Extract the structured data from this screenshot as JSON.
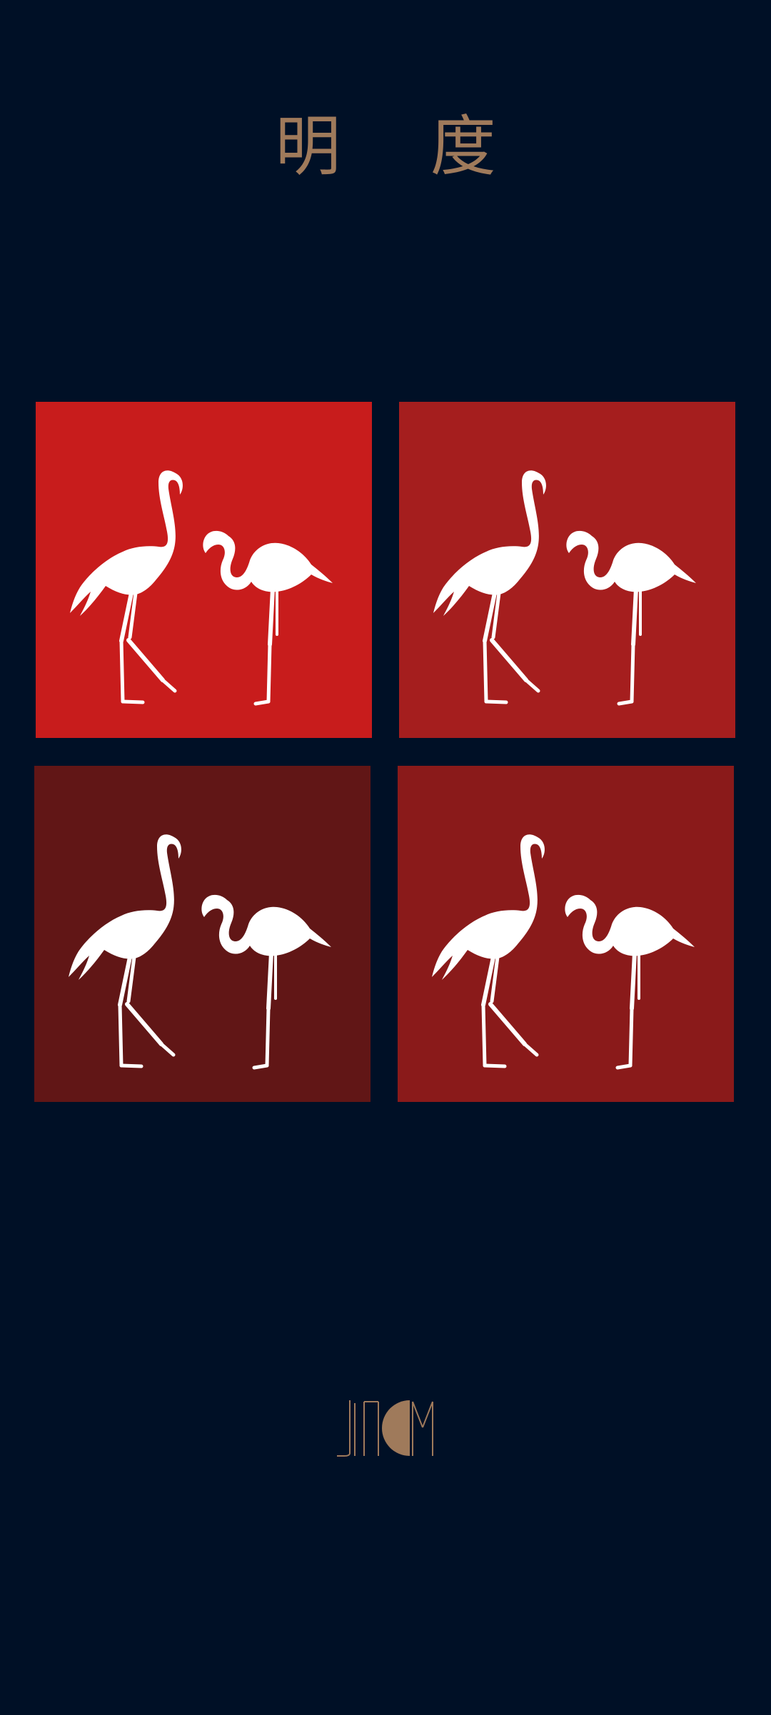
{
  "title": "明 度",
  "tiles": [
    {
      "color": "#c81c1c",
      "icon": "flamingo-pair-icon"
    },
    {
      "color": "#a51e1e",
      "icon": "flamingo-pair-icon"
    },
    {
      "color": "#611616",
      "icon": "flamingo-pair-icon"
    },
    {
      "color": "#8a1a1a",
      "icon": "flamingo-pair-icon"
    }
  ],
  "logo": {
    "text": "JNCM",
    "accent": "#9f7a5b"
  }
}
